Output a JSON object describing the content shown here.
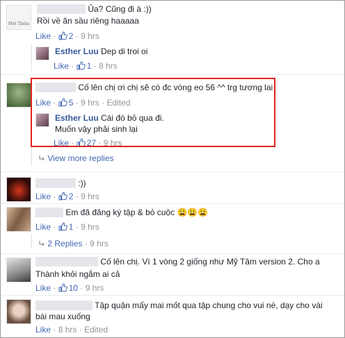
{
  "comments": [
    {
      "text": "Ủa? Cũng đi à :))",
      "text2": "Rồi về ăn sầu riêng haaaaa",
      "avatar_caption": "Mới Thêm",
      "like": "Like",
      "dot": "·",
      "likes": "2",
      "time": "9 hrs"
    },
    {
      "name": "Esther Luu",
      "text": "Dep di troi oi",
      "like": "Like",
      "dot": "·",
      "likes": "1",
      "time": "8 hrs"
    },
    {
      "text": "Cố lên chị ơi chị sẽ có đc vòng eo 56 ^^ trg tương lai",
      "like": "Like",
      "dot": "·",
      "likes": "5",
      "time": "9 hrs",
      "edited": "Edited"
    },
    {
      "name": "Esther Luu",
      "text": "Cái đó bỏ qua đi.",
      "text2": "Muốn vậy phải sinh lại",
      "like": "Like",
      "dot": "·",
      "likes": "27",
      "time": "9 hrs"
    },
    {
      "view_more": "View more replies"
    },
    {
      "text": ":))",
      "like": "Like",
      "dot": "·",
      "likes": "2",
      "time": "9 hrs"
    },
    {
      "text": "Em đã đăng ký tập & bỏ cuộc 😩😩😩",
      "like": "Like",
      "dot": "·",
      "likes": "1",
      "time": "9 hrs",
      "replies": "2 Replies",
      "replies_time": "9 hrs"
    },
    {
      "text": "Cố lên chị. Vì 1 vòng 2 giống như Mỹ Tâm version 2. Cho a",
      "text2": "Thành khỏi ngắm ai cả",
      "like": "Like",
      "dot": "·",
      "likes": "10",
      "time": "9 hrs"
    },
    {
      "text": "Tập quận mấy mai mốt qua tập chung cho vui nè, dạy cho vài",
      "text2": "bài mau xuống",
      "like": "Like",
      "dot": "·",
      "time": "8 hrs",
      "edited": "Edited"
    }
  ],
  "colors": {
    "highlight_border": "#e0221d",
    "link": "#4267b2",
    "name": "#365899",
    "meta": "#90949c"
  },
  "icons": {
    "like": "thumbs-up-icon",
    "reply_arrow": "reply-arrow-icon"
  }
}
